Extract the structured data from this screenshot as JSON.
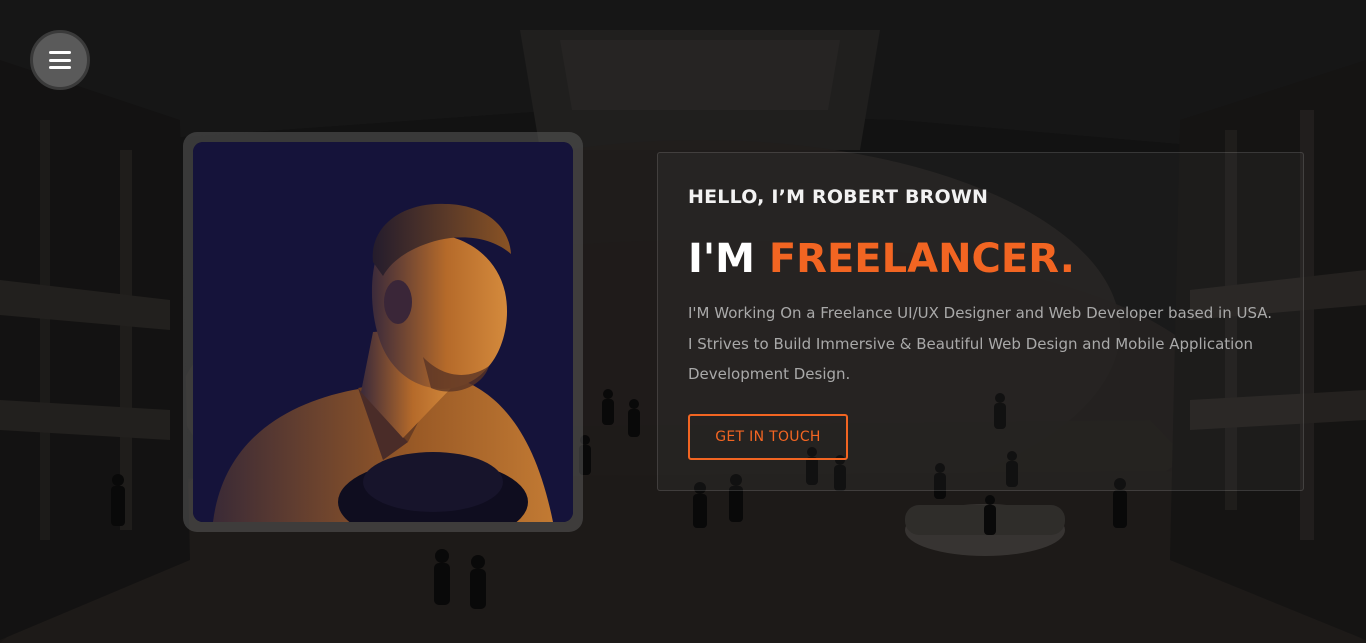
{
  "nav": {
    "menu_icon": "hamburger-menu-icon"
  },
  "hero": {
    "greeting": "HELLO, I’M ROBERT BROWN",
    "headline_prefix": "I'M ",
    "headline_accent": "FREELANCER.",
    "description": "I'M Working On a Freelance UI/UX Designer and Web Developer based in USA. I Strives to Build Immersive & Beautiful Web Design and Mobile Application Development Design.",
    "cta_label": "GET IN TOUCH"
  },
  "colors": {
    "accent": "#f26522",
    "background": "#1c1c1c",
    "text_primary": "#ffffff",
    "text_secondary": "#a9a9a9"
  }
}
